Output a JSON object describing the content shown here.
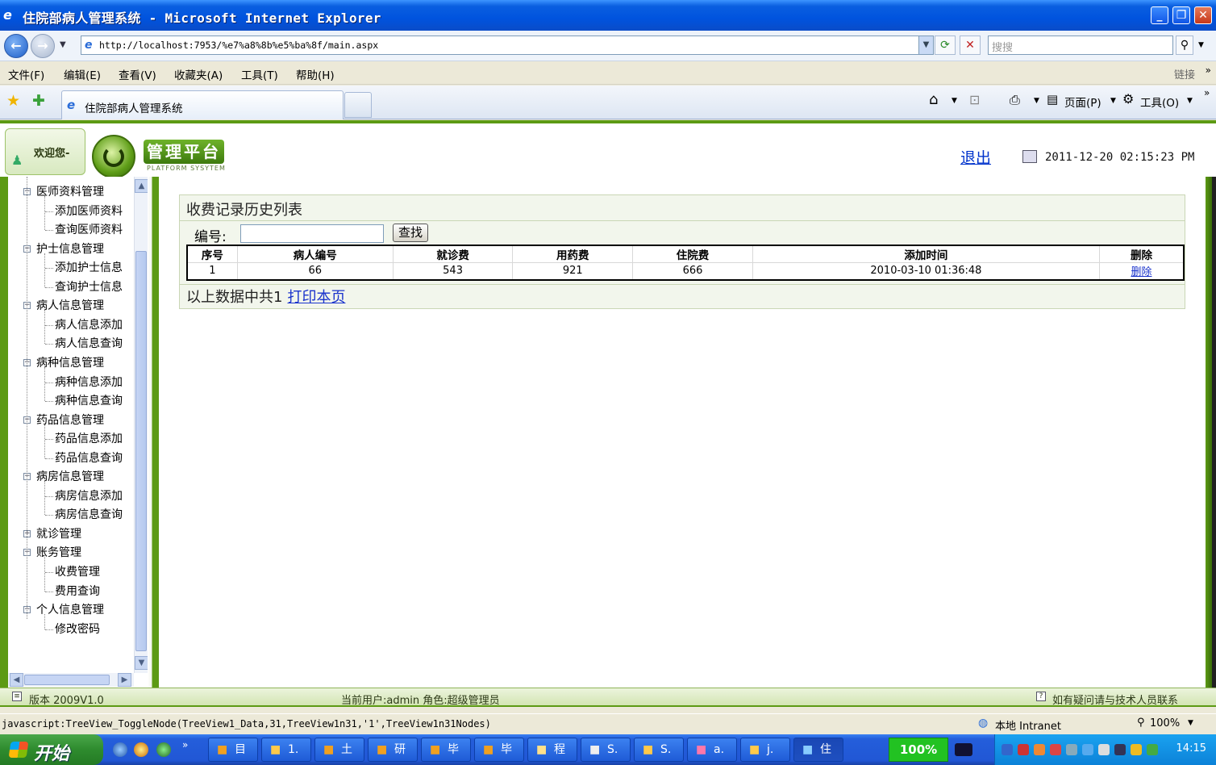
{
  "window": {
    "title": "住院部病人管理系统 - Microsoft Internet Explorer",
    "min": "_",
    "max": "❐",
    "close": "✕"
  },
  "address": {
    "url": "http://localhost:7953/%e7%a8%8b%e5%ba%8f/main.aspx",
    "search_placeholder": "搜搜"
  },
  "menu": [
    "文件(F)",
    "编辑(E)",
    "查看(V)",
    "收藏夹(A)",
    "工具(T)",
    "帮助(H)"
  ],
  "menu_links": "链接",
  "tab": {
    "label": "住院部病人管理系统"
  },
  "toolbar": {
    "page": "页面(P)",
    "tools": "工具(O)"
  },
  "header": {
    "welcome": "欢迎您-",
    "brand": "管理平台",
    "brand_sub": "PLATFORM SYSYTEM",
    "logout": "退出",
    "datetime": "2011-12-20 02:15:23 PM"
  },
  "tree": [
    {
      "label": "医师资料管理",
      "level": 0,
      "toggle": "−"
    },
    {
      "label": "添加医师资料",
      "level": 1
    },
    {
      "label": "查询医师资料",
      "level": 1
    },
    {
      "label": "护士信息管理",
      "level": 0,
      "toggle": "−"
    },
    {
      "label": "添加护士信息",
      "level": 1
    },
    {
      "label": "查询护士信息",
      "level": 1
    },
    {
      "label": "病人信息管理",
      "level": 0,
      "toggle": "−"
    },
    {
      "label": "病人信息添加",
      "level": 1
    },
    {
      "label": "病人信息查询",
      "level": 1
    },
    {
      "label": "病种信息管理",
      "level": 0,
      "toggle": "−"
    },
    {
      "label": "病种信息添加",
      "level": 1
    },
    {
      "label": "病种信息查询",
      "level": 1
    },
    {
      "label": "药品信息管理",
      "level": 0,
      "toggle": "−"
    },
    {
      "label": "药品信息添加",
      "level": 1
    },
    {
      "label": "药品信息查询",
      "level": 1
    },
    {
      "label": "病房信息管理",
      "level": 0,
      "toggle": "−"
    },
    {
      "label": "病房信息添加",
      "level": 1
    },
    {
      "label": "病房信息查询",
      "level": 1
    },
    {
      "label": "就诊管理",
      "level": 0,
      "toggle": "+"
    },
    {
      "label": "账务管理",
      "level": 0,
      "toggle": "−"
    },
    {
      "label": "收费管理",
      "level": 1
    },
    {
      "label": "费用查询",
      "level": 1
    },
    {
      "label": "个人信息管理",
      "level": 0,
      "toggle": "−"
    },
    {
      "label": "修改密码",
      "level": 1
    }
  ],
  "content": {
    "title": "收费记录历史列表",
    "search_label": "编号:",
    "search_value": "",
    "search_button": "查找",
    "columns": [
      "序号",
      "病人编号",
      "就诊费",
      "用药费",
      "住院费",
      "添加时间",
      "删除"
    ],
    "rows": [
      [
        "1",
        "66",
        "543",
        "921",
        "666",
        "2010-03-10 01:36:48",
        "删除"
      ]
    ],
    "footer_text": "以上数据中共1",
    "print_link": "打印本页"
  },
  "page_status": {
    "version": "版本 2009V1.0",
    "current_user": "当前用户:admin 角色:超级管理员",
    "help": "如有疑问请与技术人员联系"
  },
  "ie_status": {
    "message": "javascript:TreeView_ToggleNode(TreeView1_Data,31,TreeView1n31,'1',TreeView1n31Nodes)",
    "zone": "本地 Intranet",
    "zoom": "100%"
  },
  "taskbar": {
    "start": "开始",
    "tasks": [
      "目",
      "1.",
      "土",
      "研",
      "毕",
      "毕",
      "程",
      "S.",
      "S.",
      "a.",
      "j.",
      "住"
    ],
    "zoom_indicator": "100%",
    "clock": "14:15"
  }
}
